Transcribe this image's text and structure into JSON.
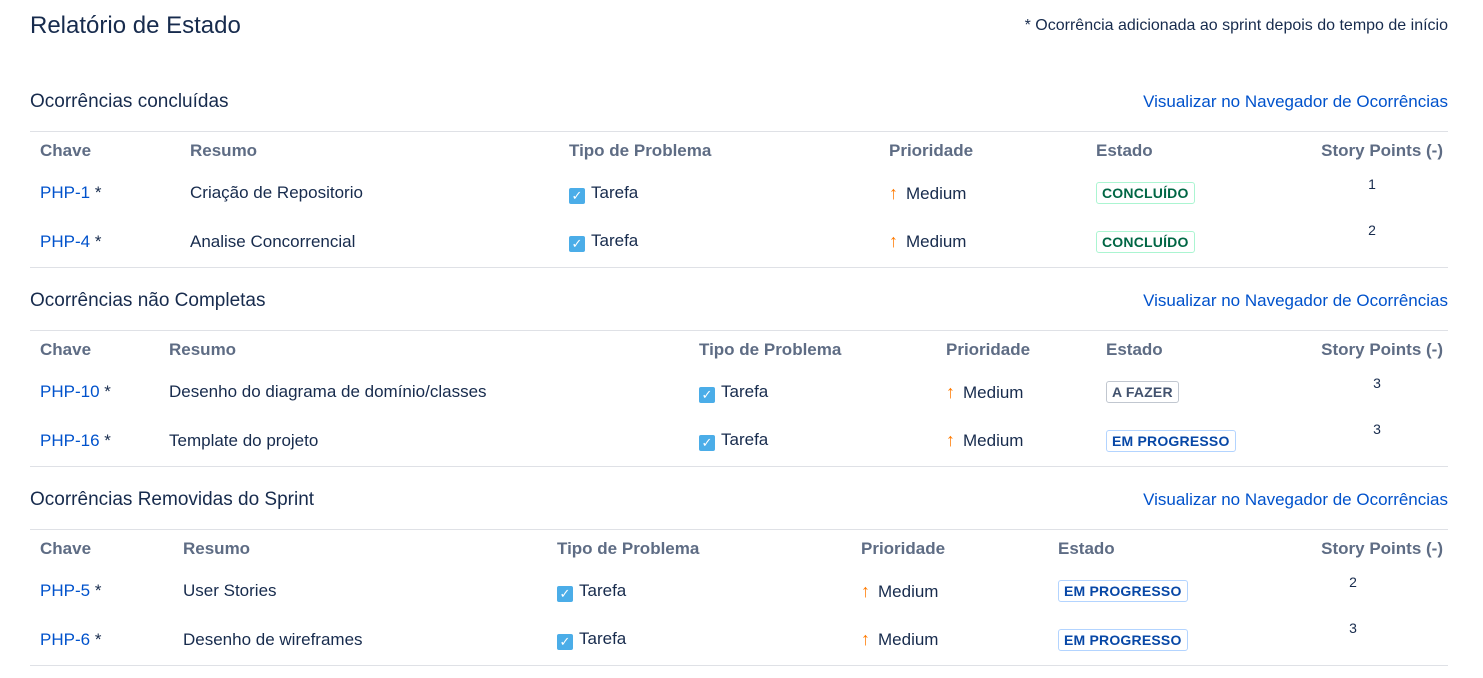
{
  "page": {
    "title": "Relatório de Estado",
    "footnote": "* Ocorrência adicionada ao sprint depois do tempo de início"
  },
  "columns": {
    "key": "Chave",
    "summary": "Resumo",
    "type": "Tipo de Problema",
    "priority": "Prioridade",
    "status": "Estado",
    "points": "Story Points (-)"
  },
  "sections": [
    {
      "title": "Ocorrências concluídas",
      "link": "Visualizar no Navegador de Ocorrências",
      "rows": [
        {
          "key": "PHP-1",
          "star": "*",
          "summary": "Criação de Repositorio",
          "type": "Tarefa",
          "priority": "Medium",
          "status": "CONCLUÍDO",
          "points": "1"
        },
        {
          "key": "PHP-4",
          "star": "*",
          "summary": "Analise Concorrencial",
          "type": "Tarefa",
          "priority": "Medium",
          "status": "CONCLUÍDO",
          "points": "2"
        }
      ]
    },
    {
      "title": "Ocorrências não Completas",
      "link": "Visualizar no Navegador de Ocorrências",
      "rows": [
        {
          "key": "PHP-10",
          "star": "*",
          "summary": "Desenho do diagrama de domínio/classes",
          "type": "Tarefa",
          "priority": "Medium",
          "status": "A FAZER",
          "points": "3"
        },
        {
          "key": "PHP-16",
          "star": "*",
          "summary": "Template do projeto",
          "type": "Tarefa",
          "priority": "Medium",
          "status": "EM PROGRESSO",
          "points": "3"
        }
      ]
    },
    {
      "title": "Ocorrências Removidas do Sprint",
      "link": "Visualizar no Navegador de Ocorrências",
      "rows": [
        {
          "key": "PHP-5",
          "star": "*",
          "summary": "User Stories",
          "type": "Tarefa",
          "priority": "Medium",
          "status": "EM PROGRESSO",
          "points": "2"
        },
        {
          "key": "PHP-6",
          "star": "*",
          "summary": "Desenho de wireframes",
          "type": "Tarefa",
          "priority": "Medium",
          "status": "EM PROGRESSO",
          "points": "3"
        }
      ]
    }
  ],
  "icons": {
    "type_icon": "task-checkbox-icon",
    "priority_icon": "priority-arrow-up-icon"
  },
  "colors": {
    "link": "#0052cc",
    "task_icon": "#4bade8",
    "priority_medium": "#ff7a00",
    "status_done": "#006644",
    "status_todo": "#42526e",
    "status_in_progress": "#0747a6"
  }
}
